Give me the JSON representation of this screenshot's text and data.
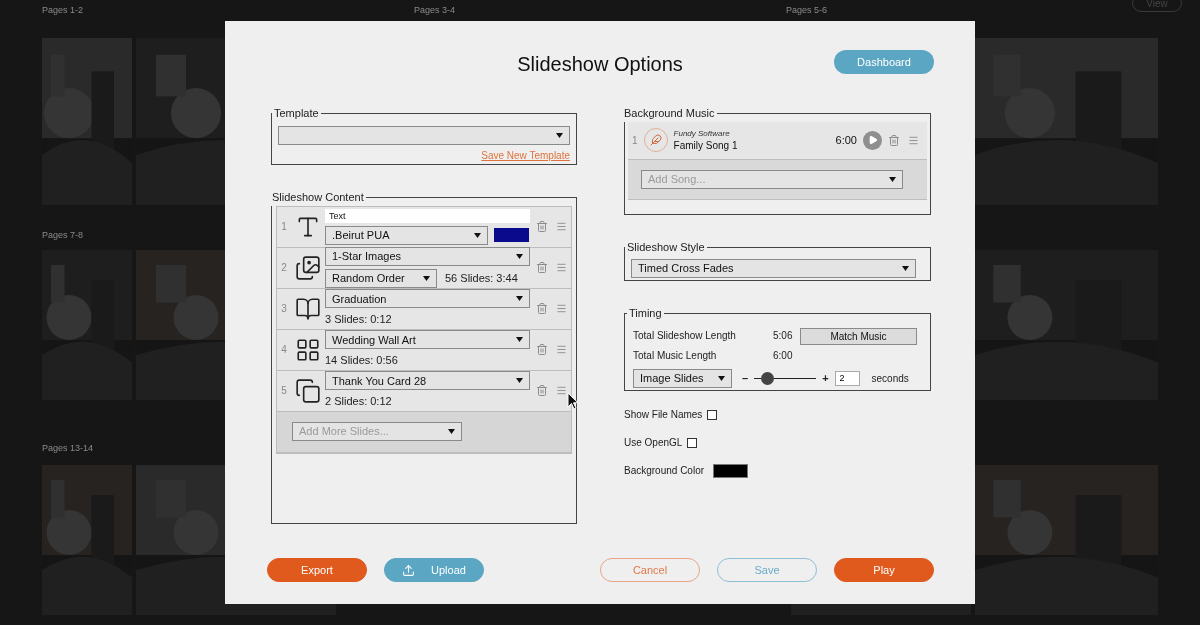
{
  "background": {
    "view_button": "View",
    "sections": [
      {
        "labels": [
          "Pages 1-2",
          "Pages 3-4",
          "Pages 5-6"
        ]
      },
      {
        "labels": [
          "Pages 7-8"
        ]
      },
      {
        "labels": [
          "Pages 13-14"
        ]
      }
    ]
  },
  "dialog": {
    "title": "Slideshow Options",
    "dashboard_button": "Dashboard",
    "template": {
      "legend": "Template",
      "link": "Save New Template"
    },
    "content": {
      "legend": "Slideshow Content",
      "items": [
        {
          "kind": "text",
          "number": "1",
          "text_value": "Text",
          "font": ".Beirut PUA",
          "color": "#0a0a8c"
        },
        {
          "kind": "images",
          "number": "2",
          "source": "1-Star Images",
          "order": "Random Order",
          "summary": "56 Slides: 3:44"
        },
        {
          "kind": "album",
          "number": "3",
          "source": "Graduation",
          "summary": "3 Slides: 0:12"
        },
        {
          "kind": "wallart",
          "number": "4",
          "source": "Wedding Wall Art",
          "summary": "14 Slides: 0:56"
        },
        {
          "kind": "card",
          "number": "5",
          "source": "Thank You Card 28",
          "summary": "2 Slides: 0:12"
        }
      ],
      "add_placeholder": "Add More Slides..."
    },
    "music": {
      "legend": "Background Music",
      "songs": [
        {
          "number": "1",
          "artist": "Fundy Software",
          "title": "Family Song 1",
          "duration": "6:00"
        }
      ],
      "add_placeholder": "Add Song..."
    },
    "style": {
      "legend": "Slideshow Style",
      "value": "Timed Cross Fades"
    },
    "timing": {
      "legend": "Timing",
      "rows": [
        {
          "label": "Total Slideshow Length",
          "value": "5:06"
        },
        {
          "label": "Total Music Length",
          "value": "6:00"
        }
      ],
      "match_button": "Match Music",
      "slide_type": "Image Slides",
      "minus": "–",
      "plus": "+",
      "slider": {
        "level": 0.2
      },
      "seconds_value": "2",
      "seconds_label": "seconds"
    },
    "options": [
      {
        "label": "Show File Names",
        "checked": false
      },
      {
        "label": "Use OpenGL",
        "checked": false
      }
    ],
    "background_color": {
      "label": "Background Color",
      "color": "#000000"
    },
    "footer_buttons": [
      {
        "kind": "export",
        "label": "Export"
      },
      {
        "kind": "upload",
        "label": "Upload"
      },
      {
        "kind": "cancel",
        "label": "Cancel"
      },
      {
        "kind": "save",
        "label": "Save"
      },
      {
        "kind": "play",
        "label": "Play"
      }
    ]
  }
}
